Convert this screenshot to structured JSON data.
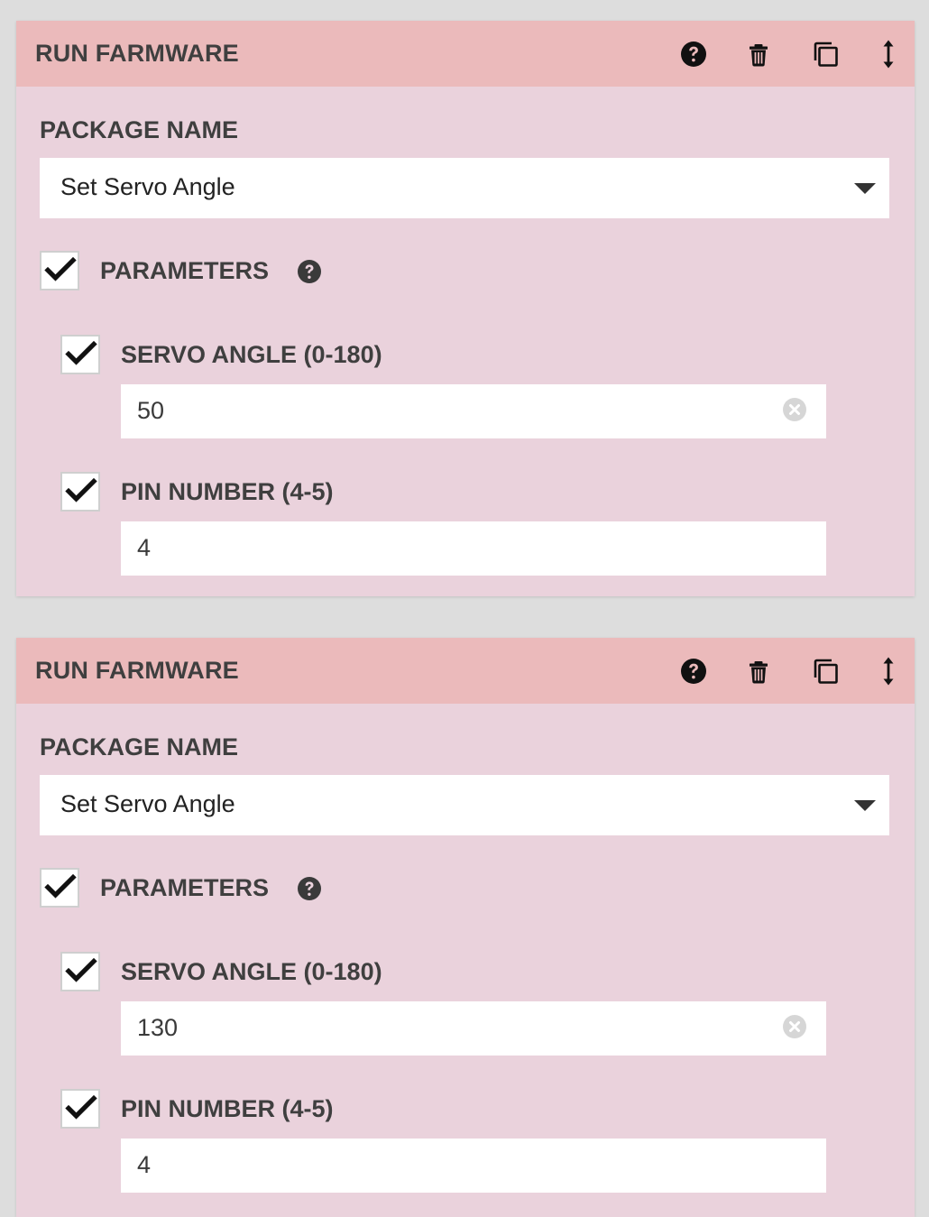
{
  "steps": [
    {
      "title": "RUN FARMWARE",
      "header_icons": [
        "help-icon",
        "trash-icon",
        "duplicate-icon",
        "drag-handle-icon"
      ],
      "package_label": "PACKAGE NAME",
      "package_value": "Set Servo Angle",
      "parameters_label": "PARAMETERS",
      "parameters_checked": true,
      "params": [
        {
          "label": "SERVO ANGLE (0-180)",
          "value": "50",
          "checked": true,
          "clearable": true
        },
        {
          "label": "PIN NUMBER (4-5)",
          "value": "4",
          "checked": true,
          "clearable": false
        }
      ]
    },
    {
      "title": "RUN FARMWARE",
      "header_icons": [
        "help-icon",
        "trash-icon",
        "duplicate-icon",
        "drag-handle-icon"
      ],
      "package_label": "PACKAGE NAME",
      "package_value": "Set Servo Angle",
      "parameters_label": "PARAMETERS",
      "parameters_checked": true,
      "params": [
        {
          "label": "SERVO ANGLE (0-180)",
          "value": "130",
          "checked": true,
          "clearable": true
        },
        {
          "label": "PIN NUMBER (4-5)",
          "value": "4",
          "checked": true,
          "clearable": false
        }
      ]
    }
  ],
  "colors": {
    "page_background": "#dddddd",
    "step_body": "#ead2dc",
    "step_header": "#ebbabb",
    "text": "#3f3f3f"
  }
}
